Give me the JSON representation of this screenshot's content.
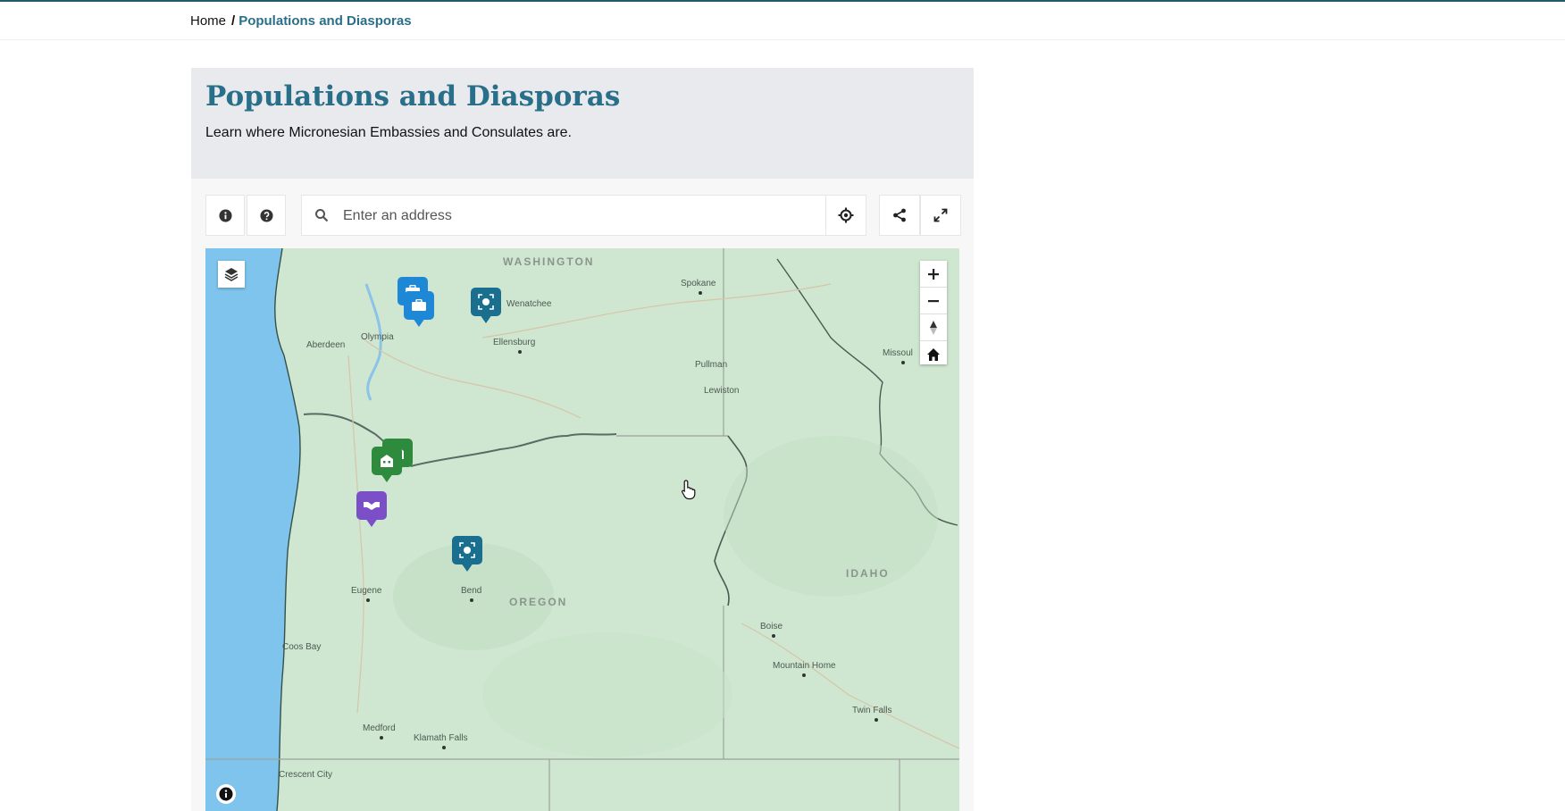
{
  "breadcrumb": {
    "home": "Home",
    "separator": "/",
    "current": "Populations and Diasporas"
  },
  "header": {
    "title": "Populations and Diasporas",
    "subtitle": "Learn where Micronesian Embassies and Consulates are."
  },
  "search": {
    "placeholder": "Enter an address",
    "value": ""
  },
  "icons": {
    "info": "info-icon",
    "help": "help-icon",
    "search": "search-icon",
    "locate": "locate-icon",
    "share": "share-icon",
    "fullscreen": "fullscreen-icon",
    "layers": "layers-icon",
    "zoom_in": "plus-icon",
    "zoom_out": "minus-icon",
    "compass": "compass-icon",
    "home": "home-icon",
    "attribution": "info-icon"
  },
  "map": {
    "state_labels": {
      "washington": "WASHINGTON",
      "oregon": "OREGON",
      "idaho": "IDAHO"
    },
    "cities": {
      "spokane": "Spokane",
      "wenatchee": "Wenatchee",
      "olympia": "Olympia",
      "aberdeen": "Aberdeen",
      "ellensburg": "Ellensburg",
      "pullman": "Pullman",
      "lewiston": "Lewiston",
      "missoula": "Missoul",
      "eugene": "Eugene",
      "bend": "Bend",
      "coos_bay": "Coos Bay",
      "medford": "Medford",
      "klamath_falls": "Klamath Falls",
      "crescent_city": "Crescent City",
      "boise": "Boise",
      "mountain_home": "Mountain Home",
      "twin_falls": "Twin Falls"
    },
    "marker_colors": {
      "blue": "#1e88d6",
      "teal": "#1a6f8f",
      "green": "#2e8b3e",
      "purple": "#7b4fc8"
    }
  },
  "colors": {
    "accent": "#2a6f89",
    "header_bg": "#e8eaed",
    "land": "#cfe6d0",
    "water": "#7fc4ec"
  }
}
